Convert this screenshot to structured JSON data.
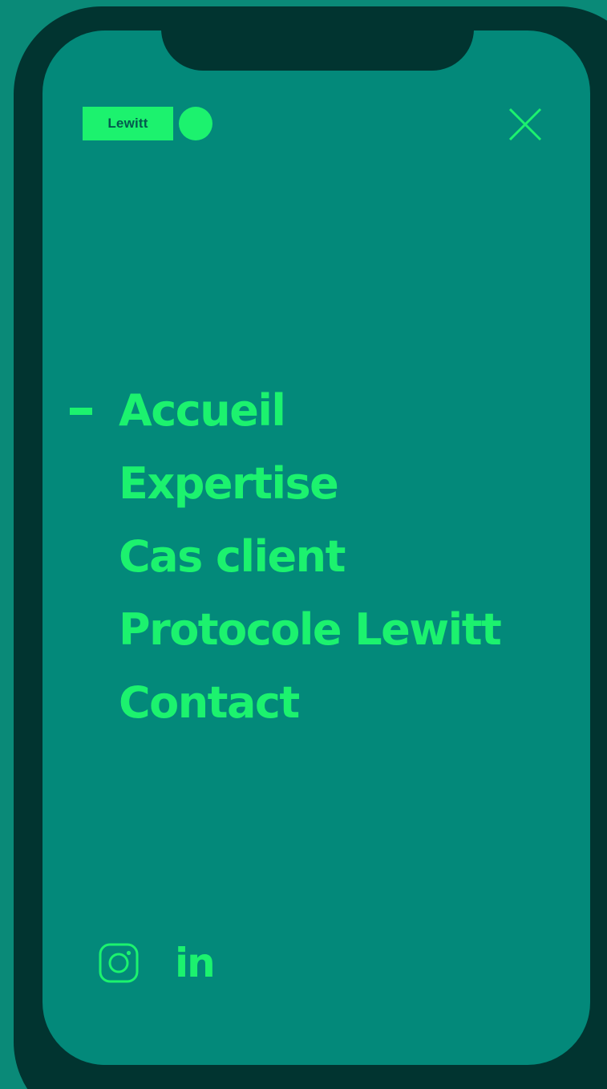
{
  "brand": {
    "logo_text": "Lewitt"
  },
  "colors": {
    "background": "#0a8a78",
    "phone_frame": "#013430",
    "screen": "#03897a",
    "accent": "#1cf26e"
  },
  "header": {
    "close_icon": "close-icon"
  },
  "menu": {
    "active_index": 0,
    "items": [
      {
        "label": "Accueil",
        "active": true
      },
      {
        "label": "Expertise",
        "active": false
      },
      {
        "label": "Cas client",
        "active": false
      },
      {
        "label": "Protocole Lewitt",
        "active": false
      },
      {
        "label": "Contact",
        "active": false
      }
    ]
  },
  "socials": {
    "instagram_icon": "instagram-icon",
    "linkedin_text": "in"
  }
}
